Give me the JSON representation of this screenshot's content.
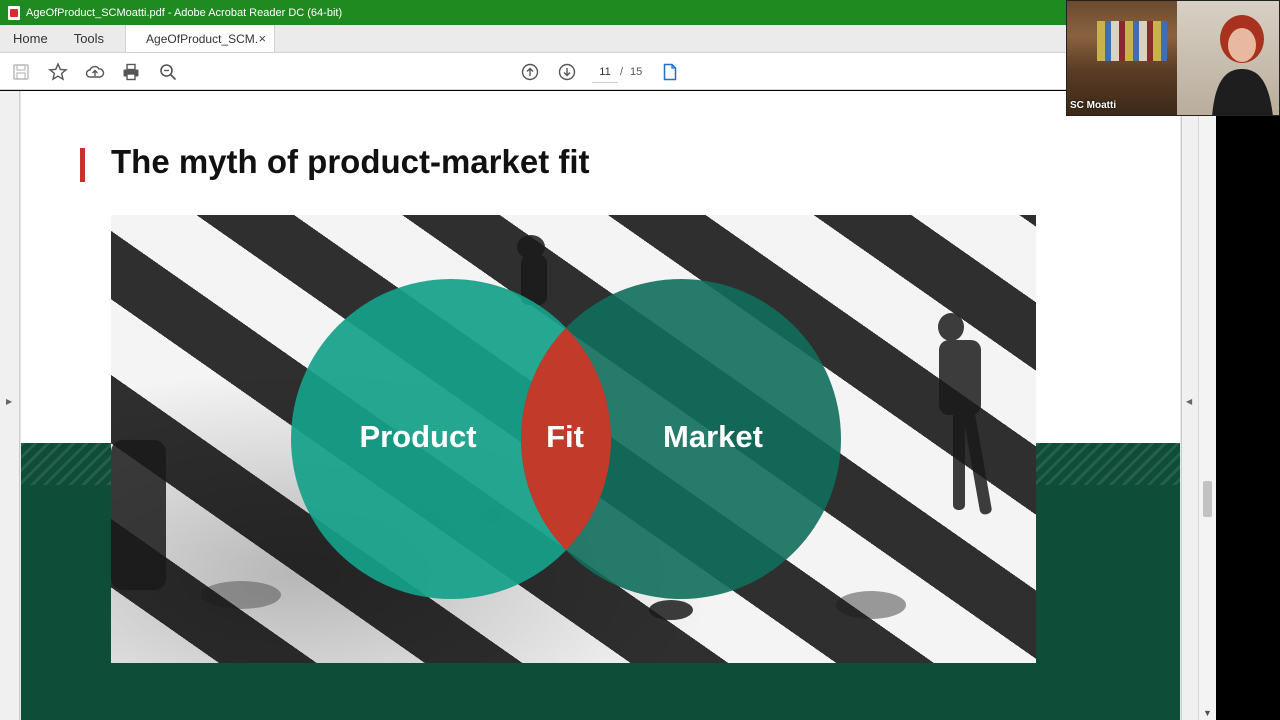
{
  "window": {
    "title": "AgeOfProduct_SCMoatti.pdf - Adobe Acrobat Reader DC (64-bit)"
  },
  "menubar": {
    "home_label": "Home",
    "tools_label": "Tools",
    "tab_label": "AgeOfProduct_SCM...",
    "tab_close": "×"
  },
  "toolbar": {
    "icons": [
      "save-icon",
      "star-icon",
      "upload-icon",
      "print-icon",
      "zoom-search-icon",
      "page-up-icon",
      "page-down-icon",
      "page-view-icon"
    ],
    "current_page": "11",
    "page_separator": "/",
    "total_pages": "15"
  },
  "slide": {
    "title": "The myth of product-market fit",
    "circles": {
      "left_label": "Product",
      "center_label": "Fit",
      "right_label": "Market"
    }
  },
  "webcam": {
    "participant_name": "SC Moatti"
  },
  "colors": {
    "titlebar": "#1f8a1f",
    "accent_red": "#c8312b",
    "teal_left": "#14a08a",
    "teal_right": "#0f6e5c",
    "band_green": "#0e4d38"
  }
}
